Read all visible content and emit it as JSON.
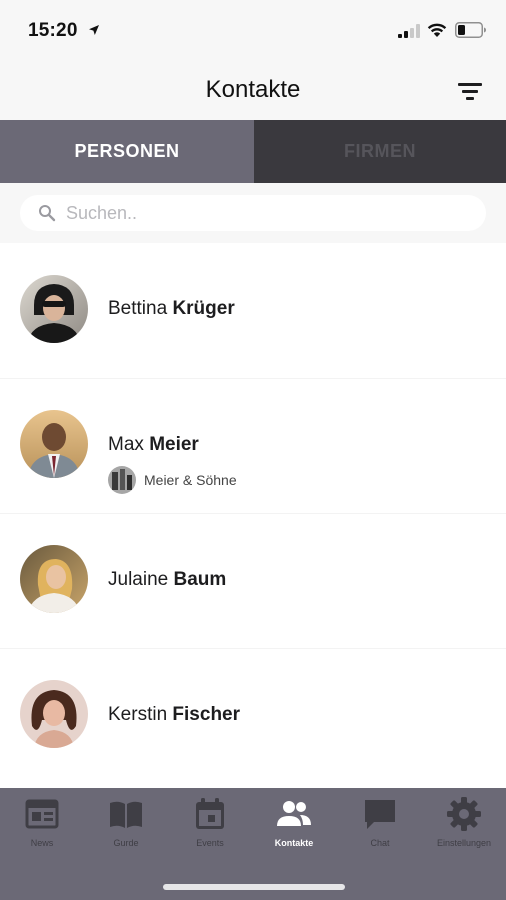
{
  "status_bar": {
    "time": "15:20"
  },
  "header": {
    "title": "Kontakte"
  },
  "segments": {
    "personen": "PERSONEN",
    "firmen": "FIRMEN"
  },
  "search": {
    "placeholder": "Suchen.."
  },
  "contacts": [
    {
      "first": "Bettina",
      "last": "Krüger"
    },
    {
      "first": "Max",
      "last": "Meier",
      "company": "Meier & Söhne"
    },
    {
      "first": "Julaine",
      "last": "Baum"
    },
    {
      "first": "Kerstin",
      "last": "Fischer"
    }
  ],
  "tabbar": {
    "items": [
      {
        "label": "News",
        "icon": "newspaper-icon"
      },
      {
        "label": "Gurde",
        "icon": "book-icon"
      },
      {
        "label": "Events",
        "icon": "calendar-icon"
      },
      {
        "label": "Kontakte",
        "icon": "people-icon",
        "active": true
      },
      {
        "label": "Chat",
        "icon": "chat-bubble-icon"
      },
      {
        "label": "Einstellungen",
        "icon": "gear-icon"
      }
    ]
  },
  "colors": {
    "accent": "#6b6976",
    "segment_inactive": "#3a393e",
    "background": "#f7f7f7"
  }
}
